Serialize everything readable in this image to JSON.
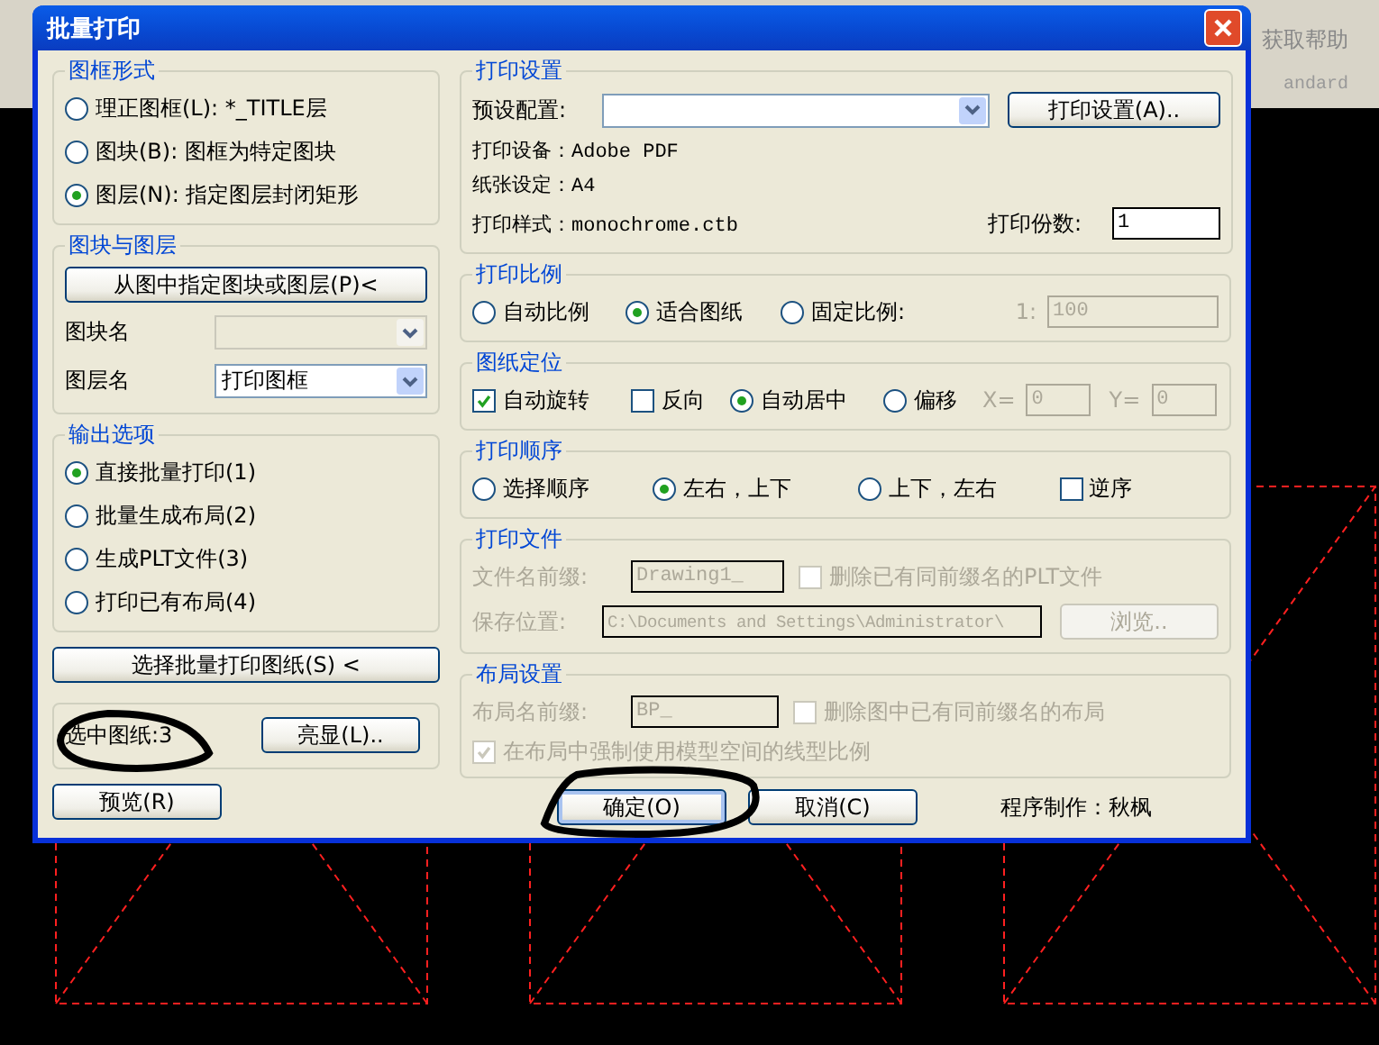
{
  "background_app": {
    "menu_item": "获取帮助",
    "toolbar_text": "andard"
  },
  "window": {
    "title": "批量打印"
  },
  "frame_type": {
    "title": "图框形式",
    "options": [
      {
        "label": "理正图框(L): *_TITLE层",
        "selected": false
      },
      {
        "label": "图块(B): 图框为特定图块",
        "selected": false
      },
      {
        "label": "图层(N): 指定图层封闭矩形",
        "selected": true
      }
    ]
  },
  "block_layer": {
    "title": "图块与图层",
    "pick_button": "从图中指定图块或图层(P)<",
    "fields": [
      {
        "label": "图块名",
        "disabled": true
      },
      {
        "label": "图层名",
        "value": "打印图框",
        "disabled": false
      }
    ]
  },
  "output": {
    "title": "输出选项",
    "options": [
      {
        "label": "直接批量打印(1)",
        "selected": true
      },
      {
        "label": "批量生成布局(2)",
        "selected": false
      },
      {
        "label": "生成PLT文件(3)",
        "selected": false
      },
      {
        "label": "打印已有布局(4)",
        "selected": false
      }
    ]
  },
  "select_button": "选择批量打印图纸(S) <",
  "selection": {
    "count": "选中图纸:3",
    "highlight_button": "亮显(L).."
  },
  "preview_button": "预览(R)",
  "print_settings": {
    "title": "打印设置",
    "preset_label": "预设配置:",
    "settings_button": "打印设置(A)..",
    "device": "打印设备：Adobe PDF",
    "paper": "纸张设定：A4",
    "style": "打印样式：monochrome.ctb",
    "copies_label": "打印份数:",
    "copies_value": "1"
  },
  "scale": {
    "title": "打印比例",
    "options": [
      {
        "label": "自动比例",
        "selected": false
      },
      {
        "label": "适合图纸",
        "selected": true
      },
      {
        "label": "固定比例:",
        "selected": false
      }
    ],
    "ratio_prefix": "1:",
    "ratio_value": "100",
    "ratio_disabled": true
  },
  "placement": {
    "title": "图纸定位",
    "items": [
      {
        "kind": "checkbox",
        "label": "自动旋转",
        "checked": true
      },
      {
        "kind": "checkbox",
        "label": "反向",
        "checked": false
      },
      {
        "kind": "radio",
        "label": "自动居中",
        "selected": true
      },
      {
        "kind": "radio",
        "label": "偏移",
        "selected": false
      }
    ],
    "offset_disabled": true,
    "x_label": "X=",
    "x_value": "0",
    "y_label": "Y=",
    "y_value": "0"
  },
  "order": {
    "title": "打印顺序",
    "options": [
      {
        "label": "选择顺序",
        "selected": false
      },
      {
        "label": "左右，上下",
        "selected": true
      },
      {
        "label": "上下，左右",
        "selected": false
      }
    ],
    "reverse": {
      "label": "逆序",
      "checked": false
    }
  },
  "file": {
    "title": "打印文件",
    "disabled": true,
    "prefix_label": "文件名前缀:",
    "prefix_value": "Drawing1_",
    "delete_label": "删除已有同前缀名的PLT文件",
    "delete_checked": false,
    "path_label": "保存位置:",
    "path_value": "C:\\Documents and Settings\\Administrator\\",
    "browse_button": "浏览.."
  },
  "layout": {
    "title": "布局设置",
    "disabled": true,
    "prefix_label": "布局名前缀:",
    "prefix_value": "BP_",
    "delete_label": "删除图中已有同前缀名的布局",
    "delete_checked": false,
    "force_label": "在布局中强制使用模型空间的线型比例",
    "force_checked": true
  },
  "buttons": [
    {
      "label": "确定(O)",
      "default": true
    },
    {
      "label": "取消(C)",
      "default": false
    }
  ],
  "credit": "程序制作：秋枫"
}
